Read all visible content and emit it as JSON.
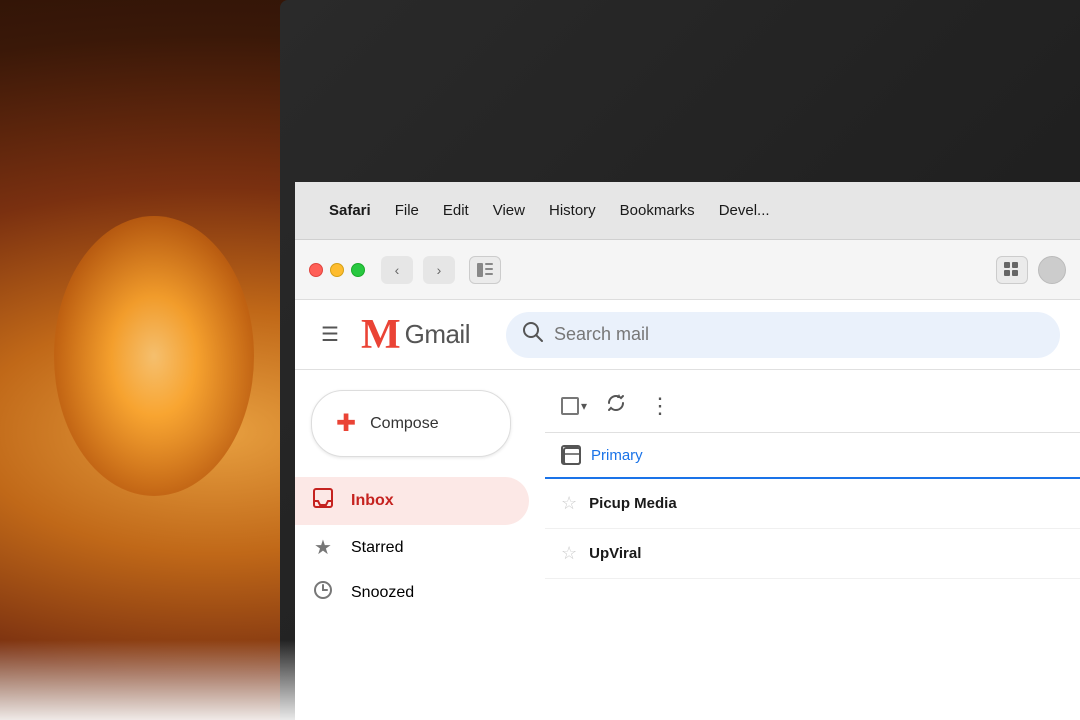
{
  "background": {
    "description": "Warm bokeh background with lamp light"
  },
  "menubar": {
    "apple_symbol": "",
    "items": [
      {
        "label": "Safari",
        "bold": true
      },
      {
        "label": "File"
      },
      {
        "label": "Edit"
      },
      {
        "label": "View"
      },
      {
        "label": "History"
      },
      {
        "label": "Bookmarks"
      },
      {
        "label": "Devel..."
      }
    ]
  },
  "browser": {
    "back_button": "‹",
    "forward_button": "›",
    "sidebar_icon": "⊡",
    "grid_icon": "⠿"
  },
  "gmail": {
    "logo_m": "M",
    "logo_text": "Gmail",
    "search_placeholder": "Search mail",
    "compose_label": "Compose",
    "nav_items": [
      {
        "id": "inbox",
        "label": "Inbox",
        "icon": "📥",
        "active": true
      },
      {
        "id": "starred",
        "label": "Starred",
        "icon": "★",
        "active": false
      },
      {
        "id": "snoozed",
        "label": "Snoozed",
        "icon": "🕐",
        "active": false
      }
    ],
    "toolbar": {
      "more_label": "⋮",
      "refresh_label": "↻"
    },
    "primary_tab": "Primary",
    "email_rows": [
      {
        "sender": "Picup Media",
        "starred": false
      },
      {
        "sender": "UpViral",
        "starred": false
      }
    ]
  }
}
